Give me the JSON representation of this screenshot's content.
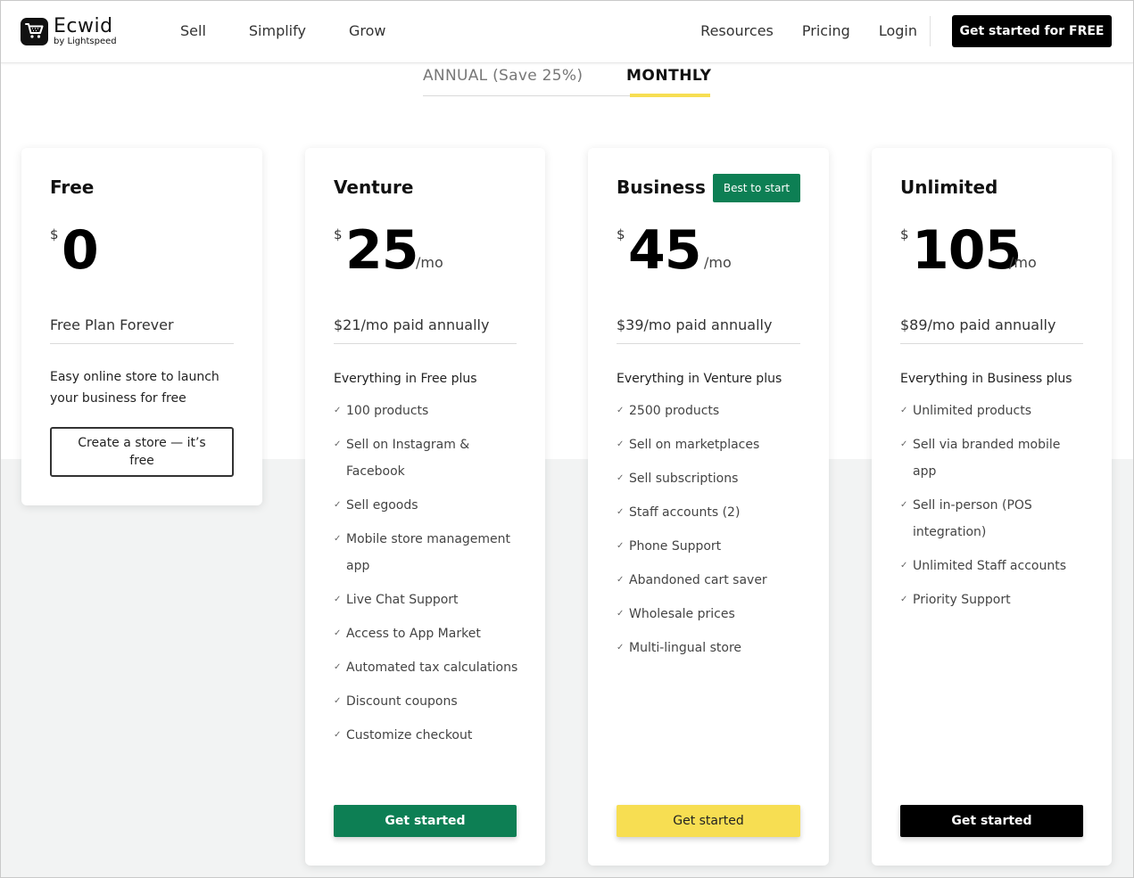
{
  "header": {
    "logo_name": "Ecwid",
    "logo_sub": "by Lightspeed",
    "nav_left": [
      "Sell",
      "Simplify",
      "Grow"
    ],
    "nav_right": [
      "Resources",
      "Pricing",
      "Login"
    ],
    "cta": "Get started for FREE"
  },
  "billing_toggle": {
    "annual": "ANNUAL (Save 25%)",
    "monthly": "MONTHLY",
    "selected": "MONTHLY"
  },
  "plans": [
    {
      "name": "Free",
      "currency": "$",
      "amount": "0",
      "per": "",
      "subline": "Free Plan Forever",
      "intro": "Easy online store to launch your business for free",
      "features": [],
      "button": "Create a store — it’s free"
    },
    {
      "name": "Venture",
      "currency": "$",
      "amount": "25",
      "per": "/mo",
      "subline": "$21/mo paid annually",
      "intro": "Everything in Free plus",
      "features": [
        "100 products",
        "Sell on Instagram & Facebook",
        "Sell egoods",
        "Mobile store management app",
        "Live Chat Support",
        "Access to App Market",
        "Automated tax calculations",
        "Discount coupons",
        "Customize checkout"
      ],
      "button": "Get started",
      "button_color": "#0d7f54"
    },
    {
      "name": "Business",
      "badge": "Best to start",
      "currency": "$",
      "amount": "45",
      "per": "/mo",
      "subline": "$39/mo paid annually",
      "intro": "Everything in Venture plus",
      "features": [
        "2500 products",
        "Sell on marketplaces",
        "Sell subscriptions",
        "Staff accounts (2)",
        "Phone Support",
        "Abandoned cart saver",
        "Wholesale prices",
        "Multi-lingual store"
      ],
      "button": "Get started",
      "button_color": "#f7de52"
    },
    {
      "name": "Unlimited",
      "currency": "$",
      "amount": "105",
      "per": "/mo",
      "subline": "$89/mo paid annually",
      "intro": "Everything in Business plus",
      "features": [
        "Unlimited products",
        "Sell via branded mobile app",
        "Sell in-person (POS integration)",
        "Unlimited Staff accounts",
        "Priority Support"
      ],
      "button": "Get started",
      "button_color": "#000000"
    }
  ],
  "icons": {
    "check": "check-icon",
    "cart": "cart-icon"
  },
  "colors": {
    "accent_green": "#0d7f54",
    "accent_yellow": "#f7de52",
    "black": "#000000"
  }
}
